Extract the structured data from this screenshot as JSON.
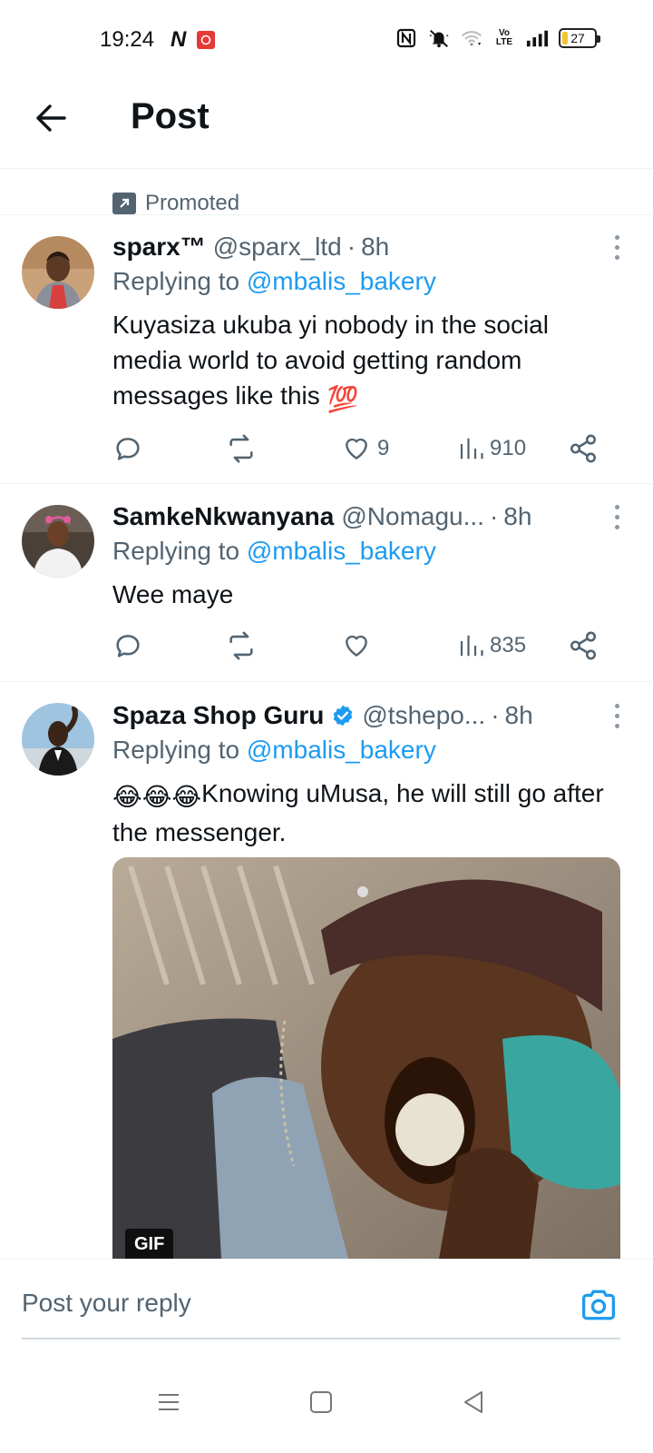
{
  "status_bar": {
    "time": "19:24",
    "battery": "27",
    "battery_level_percent": 27,
    "network": "VoLTE",
    "icons": [
      "netflix-icon",
      "red-app-icon",
      "nfc-icon",
      "mute-icon",
      "wifi-icon",
      "volte-icon",
      "signal-icon",
      "battery-icon"
    ]
  },
  "header": {
    "title": "Post",
    "back_icon": "arrow-left-icon"
  },
  "promoted": {
    "label": "Promoted"
  },
  "tweets": [
    {
      "name": "sparx™",
      "handle": "@sparx_ltd",
      "dot": "·",
      "time": "8h",
      "replying_prefix": "Replying to",
      "replying_to": "@mbalis_bakery",
      "text": "Kuyasiza ukuba yi nobody in the social media world to avoid getting random messages like this",
      "text_emoji": "💯",
      "likes": "9",
      "views": "910"
    },
    {
      "name": "SamkeNkwanyana",
      "handle": "@Nomagu...",
      "dot": "·",
      "time": "8h",
      "replying_prefix": "Replying to",
      "replying_to": "@mbalis_bakery",
      "text": "Wee maye",
      "likes": "",
      "views": "835"
    },
    {
      "name": "Spaza Shop Guru",
      "handle": "@tshepo...",
      "dot": "·",
      "time": "8h",
      "verified": true,
      "replying_prefix": "Replying to",
      "replying_to": "@mbalis_bakery",
      "text_emoji": "😂😂😂",
      "text": "Knowing uMusa, he will still go after the messenger.",
      "media_badge": "GIF"
    }
  ],
  "reply_bar": {
    "placeholder": "Post your reply",
    "camera_icon": "camera-icon"
  },
  "nav_bar": {
    "icons": [
      "menu-icon",
      "home-square-icon",
      "back-triangle-icon"
    ]
  },
  "colors": {
    "accent": "#1d9bf0",
    "secondary_text": "#536471",
    "divider": "#eff3f4",
    "battery": "#f4c430"
  }
}
